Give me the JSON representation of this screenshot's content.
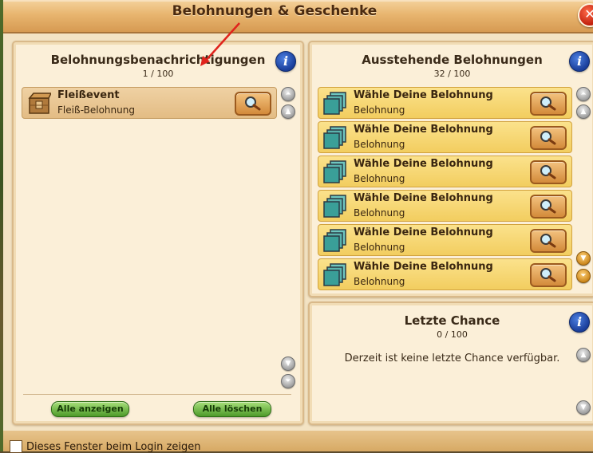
{
  "window": {
    "title": "Belohnungen & Geschenke",
    "close_symbol": "✕"
  },
  "left_panel": {
    "title": "Belohnungsbenachrichtigungen",
    "count": "1 / 100",
    "items": [
      {
        "title": "Fleißevent",
        "subtitle": "Fleiß-Belohnung",
        "icon": "crate-icon"
      }
    ],
    "buttons": {
      "show_all": "Alle anzeigen",
      "delete_all": "Alle löschen"
    }
  },
  "right_top_panel": {
    "title": "Ausstehende Belohnungen",
    "count": "32 / 100",
    "items": [
      {
        "title": "Wähle Deine Belohnung",
        "subtitle": "Belohnung",
        "icon": "choice-card-icon"
      },
      {
        "title": "Wähle Deine Belohnung",
        "subtitle": "Belohnung",
        "icon": "choice-card-icon"
      },
      {
        "title": "Wähle Deine Belohnung",
        "subtitle": "Belohnung",
        "icon": "choice-card-icon"
      },
      {
        "title": "Wähle Deine Belohnung",
        "subtitle": "Belohnung",
        "icon": "choice-card-icon"
      },
      {
        "title": "Wähle Deine Belohnung",
        "subtitle": "Belohnung",
        "icon": "choice-card-icon"
      },
      {
        "title": "Wähle Deine Belohnung",
        "subtitle": "Belohnung",
        "icon": "choice-card-icon"
      }
    ]
  },
  "right_bottom_panel": {
    "title": "Letzte Chance",
    "count": "0 / 100",
    "empty_text": "Derzeit ist keine letzte Chance verfügbar."
  },
  "footer": {
    "checkbox_label": "Dieses Fenster beim Login zeigen",
    "checked": false
  },
  "info_symbol": "i",
  "colors": {
    "accent_info": "#1a3e9a",
    "row_yellow": "#f2cd5f",
    "row_tan": "#e3bc84",
    "button_green": "#4e9a2a",
    "close_red": "#c0200c"
  }
}
